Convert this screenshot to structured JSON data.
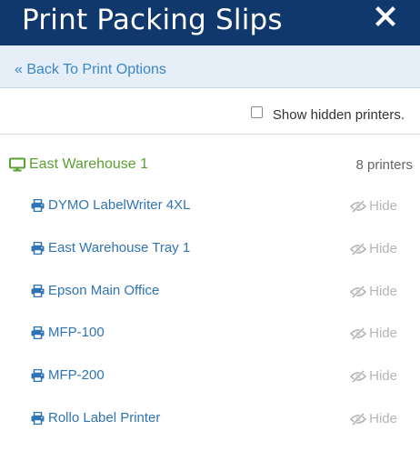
{
  "header": {
    "title": "Print Packing Slips",
    "close_icon": "close-icon"
  },
  "back_link": {
    "label": "« Back To Print Options"
  },
  "hidden_toggle": {
    "label": "Show hidden printers.",
    "checked": false
  },
  "group": {
    "name": "East Warehouse 1",
    "count_label": "8 printers",
    "icon": "desktop-icon"
  },
  "printers": [
    {
      "name": "DYMO LabelWriter 4XL",
      "hide_label": "Hide"
    },
    {
      "name": "East Warehouse Tray 1",
      "hide_label": "Hide"
    },
    {
      "name": "Epson Main Office",
      "hide_label": "Hide"
    },
    {
      "name": "MFP-100",
      "hide_label": "Hide"
    },
    {
      "name": "MFP-200",
      "hide_label": "Hide"
    },
    {
      "name": "Rollo Label Printer",
      "hide_label": "Hide"
    }
  ],
  "colors": {
    "header_bg": "#10386c",
    "link": "#2f74b5",
    "group_green": "#5ba033",
    "hide_gray": "#b5b5b5"
  }
}
